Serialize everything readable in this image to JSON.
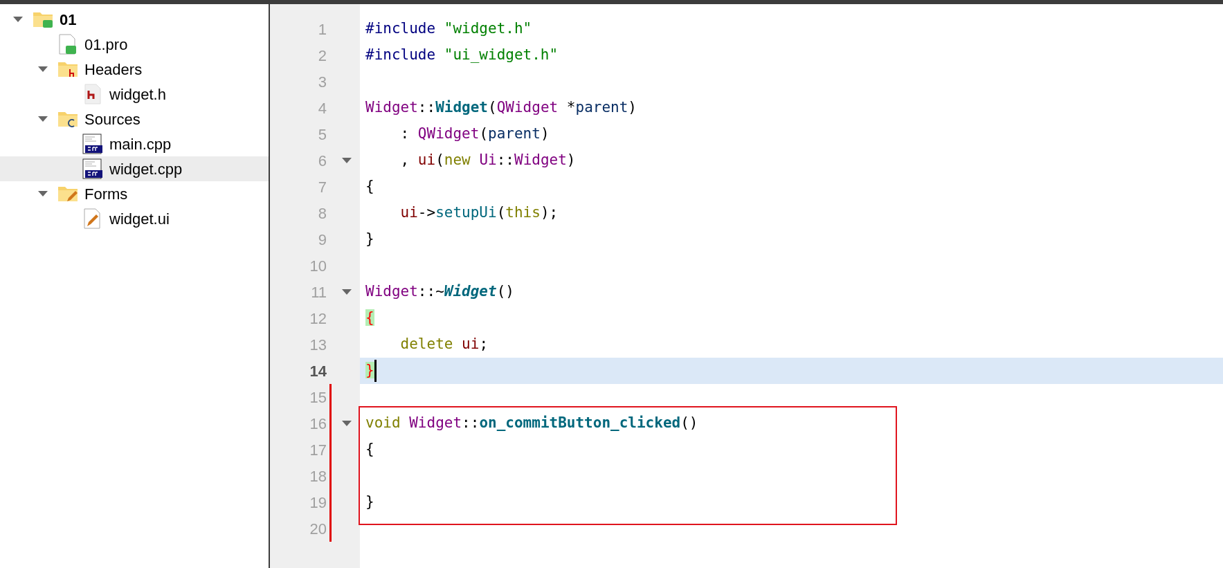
{
  "project_tree": [
    {
      "label": "01",
      "kind": "qt-folder",
      "bold": true,
      "expanded": true,
      "selected": false,
      "children": [
        {
          "label": "01.pro",
          "kind": "qt-file",
          "bold": false,
          "selected": false
        },
        {
          "label": "Headers",
          "kind": "h-folder",
          "bold": false,
          "expanded": true,
          "selected": false,
          "children": [
            {
              "label": "widget.h",
              "kind": "h-file",
              "bold": false,
              "selected": false
            }
          ]
        },
        {
          "label": "Sources",
          "kind": "cpp-folder",
          "bold": false,
          "expanded": true,
          "selected": false,
          "children": [
            {
              "label": "main.cpp",
              "kind": "cpp-file",
              "bold": false,
              "selected": false
            },
            {
              "label": "widget.cpp",
              "kind": "cpp-file",
              "bold": false,
              "selected": true
            }
          ]
        },
        {
          "label": "Forms",
          "kind": "form-folder",
          "bold": false,
          "expanded": true,
          "selected": false,
          "children": [
            {
              "label": "widget.ui",
              "kind": "form-file",
              "bold": false,
              "selected": false
            }
          ]
        }
      ]
    }
  ],
  "editor": {
    "lines": [
      {
        "number": "1",
        "current": false,
        "tokens": [
          {
            "text": "#include ",
            "kind": "preproc"
          },
          {
            "text": "\"widget.h\"",
            "kind": "string"
          }
        ]
      },
      {
        "number": "2",
        "current": false,
        "tokens": [
          {
            "text": "#include ",
            "kind": "preproc"
          },
          {
            "text": "\"ui_widget.h\"",
            "kind": "string"
          }
        ]
      },
      {
        "number": "3",
        "current": false
      },
      {
        "number": "4",
        "current": false,
        "tokens": [
          {
            "text": "Widget",
            "kind": "type"
          },
          {
            "text": "::",
            "kind": "plain"
          },
          {
            "text": "Widget",
            "kind": "declaration"
          },
          {
            "text": "(",
            "kind": "plain"
          },
          {
            "text": "QWidget",
            "kind": "type"
          },
          {
            "text": " *",
            "kind": "plain"
          },
          {
            "text": "parent",
            "kind": "param"
          },
          {
            "text": ")",
            "kind": "plain"
          }
        ]
      },
      {
        "number": "5",
        "current": false,
        "tokens": [
          {
            "text": "    : ",
            "kind": "plain"
          },
          {
            "text": "QWidget",
            "kind": "type"
          },
          {
            "text": "(",
            "kind": "plain"
          },
          {
            "text": "parent",
            "kind": "param"
          },
          {
            "text": ")",
            "kind": "plain"
          }
        ]
      },
      {
        "number": "6",
        "current": false,
        "foldable": true,
        "tokens": [
          {
            "text": "    , ",
            "kind": "plain"
          },
          {
            "text": "ui",
            "kind": "member"
          },
          {
            "text": "(",
            "kind": "plain"
          },
          {
            "text": "new ",
            "kind": "keyword"
          },
          {
            "text": "Ui",
            "kind": "type"
          },
          {
            "text": "::",
            "kind": "plain"
          },
          {
            "text": "Widget",
            "kind": "type"
          },
          {
            "text": ")",
            "kind": "plain"
          }
        ]
      },
      {
        "number": "7",
        "current": false,
        "tokens": [
          {
            "text": "{",
            "kind": "plain"
          }
        ]
      },
      {
        "number": "8",
        "current": false,
        "tokens": [
          {
            "text": "    ui",
            "kind": "member"
          },
          {
            "text": "->",
            "kind": "plain"
          },
          {
            "text": "setupUi",
            "kind": "function"
          },
          {
            "text": "(",
            "kind": "plain"
          },
          {
            "text": "this",
            "kind": "keyword"
          },
          {
            "text": ");",
            "kind": "plain"
          }
        ]
      },
      {
        "number": "9",
        "current": false,
        "tokens": [
          {
            "text": "}",
            "kind": "plain"
          }
        ]
      },
      {
        "number": "10",
        "current": false
      },
      {
        "number": "11",
        "current": false,
        "foldable": true,
        "tokens": [
          {
            "text": "Widget",
            "kind": "type"
          },
          {
            "text": "::~",
            "kind": "plain"
          },
          {
            "text": "Widget",
            "kind": "virtual-declaration"
          },
          {
            "text": "()",
            "kind": "plain"
          }
        ]
      },
      {
        "number": "12",
        "current": false,
        "tokens": [
          {
            "text": "{",
            "kind": "brace-match"
          }
        ]
      },
      {
        "number": "13",
        "current": false,
        "tokens": [
          {
            "text": "    delete ",
            "kind": "keyword"
          },
          {
            "text": "ui",
            "kind": "member"
          },
          {
            "text": ";",
            "kind": "plain"
          }
        ]
      },
      {
        "number": "14",
        "current": true,
        "tokens": [
          {
            "text": "}",
            "kind": "brace-match"
          }
        ]
      },
      {
        "number": "15",
        "current": false,
        "changed": true
      },
      {
        "number": "16",
        "current": false,
        "foldable": true,
        "changed": true,
        "boxed": true,
        "tokens": [
          {
            "text": "void ",
            "kind": "keyword"
          },
          {
            "text": "Widget",
            "kind": "type"
          },
          {
            "text": "::",
            "kind": "plain"
          },
          {
            "text": "on_commitButton_clicked",
            "kind": "declaration"
          },
          {
            "text": "()",
            "kind": "plain"
          }
        ]
      },
      {
        "number": "17",
        "current": false,
        "changed": true,
        "boxed": true,
        "tokens": [
          {
            "text": "{",
            "kind": "plain"
          }
        ]
      },
      {
        "number": "18",
        "current": false,
        "changed": true,
        "boxed": true
      },
      {
        "number": "19",
        "current": false,
        "changed": true,
        "boxed": true,
        "tokens": [
          {
            "text": "}",
            "kind": "plain"
          }
        ]
      },
      {
        "number": "20",
        "current": false,
        "changed": true
      }
    ]
  }
}
